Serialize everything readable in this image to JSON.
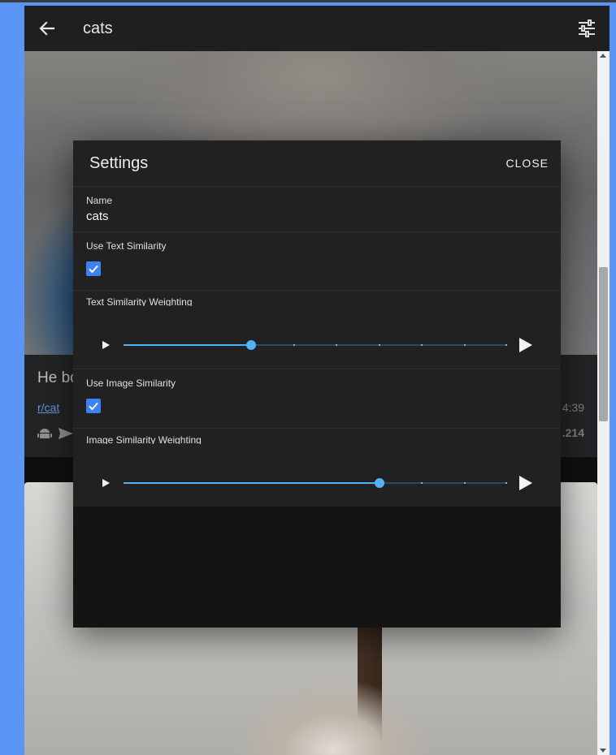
{
  "app_bar": {
    "title": "cats",
    "back_icon": "arrow-back-icon",
    "settings_icon": "tune-icon"
  },
  "feed": {
    "post": {
      "title": "He bo",
      "subreddit": "r/cat",
      "time": "4:39",
      "score": ".214"
    }
  },
  "dialog": {
    "title": "Settings",
    "close_label": "CLOSE",
    "name_label": "Name",
    "name_value": "cats",
    "text_similarity_label": "Use Text Similarity",
    "text_similarity_checked": true,
    "text_weight_label": "Text Similarity Weighting",
    "text_weight_value": 0.333,
    "image_similarity_label": "Use Image Similarity",
    "image_similarity_checked": true,
    "image_weight_label": "Image Similarity Weighting",
    "image_weight_value": 0.667
  },
  "colors": {
    "accent": "#4fb3f6",
    "checkbox": "#3b82f6",
    "background": "#121212"
  }
}
